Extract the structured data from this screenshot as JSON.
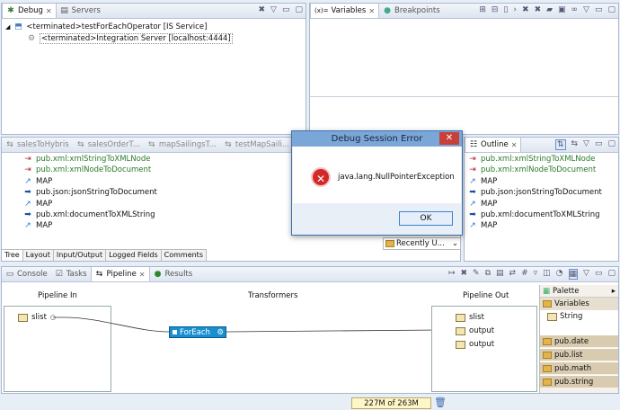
{
  "debug_view": {
    "tabs": [
      "Debug",
      "Servers"
    ],
    "items": [
      "<terminated>testForEachOperator [IS Service]",
      "<terminated>Integration Server [localhost:4444]"
    ]
  },
  "variables_view": {
    "tabs": [
      "Variables",
      "Breakpoints"
    ],
    "prefix": "(x)="
  },
  "editor": {
    "tabs": [
      "salesToHybris",
      "salesOrderT...",
      "mapSailingsT...",
      "testMapSaili..."
    ],
    "items": [
      {
        "label": "pub.xml:xmlStringToXMLNode",
        "kind": "invoke"
      },
      {
        "label": "pub.xml:xmlNodeToDocument",
        "kind": "invoke"
      },
      {
        "label": "MAP",
        "kind": "map"
      },
      {
        "label": "pub.json:jsonStringToDocument",
        "kind": "invoke-blue"
      },
      {
        "label": "MAP",
        "kind": "map"
      },
      {
        "label": "pub.xml:documentToXMLString",
        "kind": "invoke-blue"
      },
      {
        "label": "MAP",
        "kind": "map"
      }
    ],
    "bottom_tabs": [
      "Tree",
      "Layout",
      "Input/Output",
      "Logged Fields",
      "Comments"
    ],
    "recently_used": "Recently U..."
  },
  "outline": {
    "tab": "Outline",
    "items": [
      {
        "label": "pub.xml:xmlStringToXMLNode",
        "kind": "invoke"
      },
      {
        "label": "pub.xml:xmlNodeToDocument",
        "kind": "invoke"
      },
      {
        "label": "MAP",
        "kind": "map"
      },
      {
        "label": "pub.json:jsonStringToDocument",
        "kind": "invoke-blue"
      },
      {
        "label": "MAP",
        "kind": "map"
      },
      {
        "label": "pub.xml:documentToXMLString",
        "kind": "invoke-blue"
      },
      {
        "label": "MAP",
        "kind": "map"
      }
    ]
  },
  "dialog": {
    "title": "Debug Session Error",
    "close": "✕",
    "message": "java.lang.NullPointerException",
    "ok": "OK"
  },
  "bottom_views": {
    "tabs": [
      "Console",
      "Tasks",
      "Pipeline",
      "Results"
    ],
    "active": "Pipeline"
  },
  "pipeline": {
    "in_header": "Pipeline In",
    "transformers_header": "Transformers",
    "out_header": "Pipeline Out",
    "in_items": [
      "slist"
    ],
    "transformer": "ForEach",
    "out_items": [
      "slist",
      "output",
      "output"
    ]
  },
  "palette": {
    "title": "Palette",
    "variables": "Variables",
    "string": "String",
    "folders": [
      "pub.date",
      "pub.list",
      "pub.math",
      "pub.string"
    ]
  },
  "status": {
    "memory": "227M of 263M"
  }
}
